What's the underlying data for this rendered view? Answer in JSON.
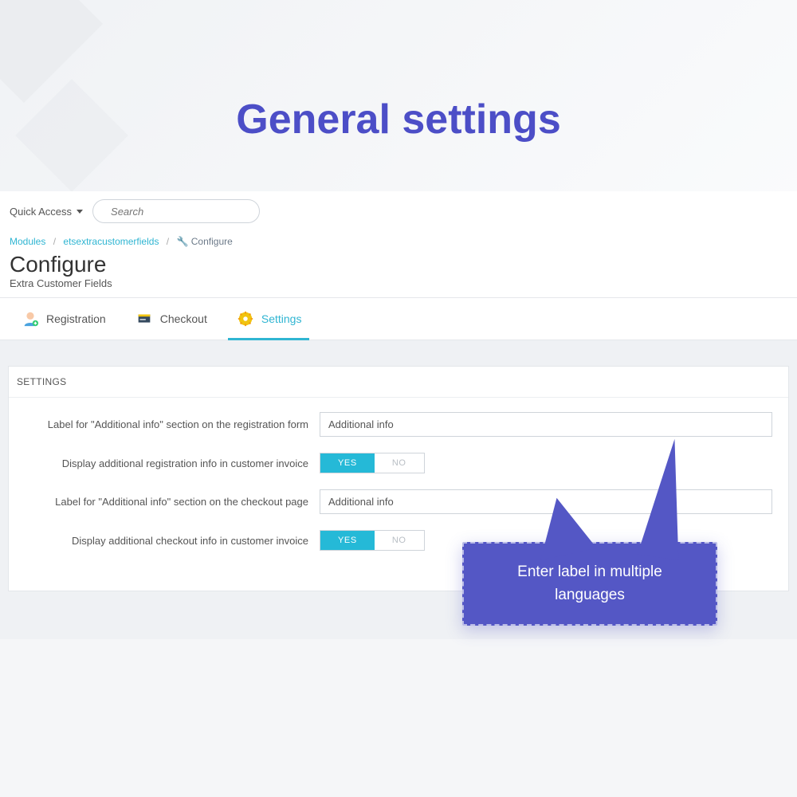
{
  "hero": {
    "title": "General settings"
  },
  "topbar": {
    "quick_access": "Quick Access",
    "search_placeholder": "Search"
  },
  "breadcrumb": {
    "modules": "Modules",
    "module_name": "etsextracustomerfields",
    "configure": "Configure"
  },
  "header": {
    "title": "Configure",
    "subtitle": "Extra Customer Fields"
  },
  "tabs": {
    "registration": "Registration",
    "checkout": "Checkout",
    "settings": "Settings"
  },
  "panel": {
    "title": "SETTINGS",
    "fields": {
      "reg_label": {
        "label": "Label for \"Additional info\" section on the registration form",
        "value": "Additional info"
      },
      "reg_invoice": {
        "label": "Display additional registration info in customer invoice",
        "yes": "YES",
        "no": "NO"
      },
      "checkout_label": {
        "label": "Label for \"Additional info\" section on the checkout page",
        "value": "Additional info"
      },
      "checkout_invoice": {
        "label": "Display additional checkout info in customer invoice",
        "yes": "YES",
        "no": "NO"
      }
    }
  },
  "callout": {
    "text": "Enter label in multiple languages"
  }
}
